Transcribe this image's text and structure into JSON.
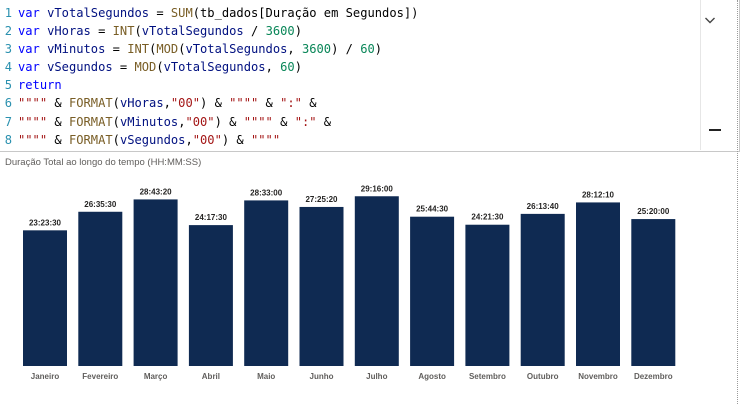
{
  "editor": {
    "lines": [
      {
        "n": "1",
        "tokens": [
          [
            "kw",
            "var "
          ],
          [
            "id",
            "vTotalSegundos"
          ],
          [
            "col",
            " = "
          ],
          [
            "fn",
            "SUM"
          ],
          [
            "col",
            "(tb_dados[Duração em Segundos])"
          ]
        ]
      },
      {
        "n": "2",
        "tokens": [
          [
            "kw",
            "var "
          ],
          [
            "id",
            "vHoras"
          ],
          [
            "col",
            " = "
          ],
          [
            "fn",
            "INT"
          ],
          [
            "col",
            "("
          ],
          [
            "id",
            "vTotalSegundos"
          ],
          [
            "col",
            " / "
          ],
          [
            "num",
            "3600"
          ],
          [
            "col",
            ")"
          ]
        ]
      },
      {
        "n": "3",
        "tokens": [
          [
            "kw",
            "var "
          ],
          [
            "id",
            "vMinutos"
          ],
          [
            "col",
            " = "
          ],
          [
            "fn",
            "INT"
          ],
          [
            "col",
            "("
          ],
          [
            "fn",
            "MOD"
          ],
          [
            "col",
            "("
          ],
          [
            "id",
            "vTotalSegundos"
          ],
          [
            "col",
            ", "
          ],
          [
            "num",
            "3600"
          ],
          [
            "col",
            ") / "
          ],
          [
            "num",
            "60"
          ],
          [
            "col",
            ")"
          ]
        ]
      },
      {
        "n": "4",
        "tokens": [
          [
            "kw",
            "var "
          ],
          [
            "id",
            "vSegundos"
          ],
          [
            "col",
            " = "
          ],
          [
            "fn",
            "MOD"
          ],
          [
            "col",
            "("
          ],
          [
            "id",
            "vTotalSegundos"
          ],
          [
            "col",
            ", "
          ],
          [
            "num",
            "60"
          ],
          [
            "col",
            ")"
          ]
        ]
      },
      {
        "n": "5",
        "tokens": [
          [
            "kw",
            "return"
          ]
        ]
      },
      {
        "n": "6",
        "tokens": [
          [
            "str",
            "\"\"\"\""
          ],
          [
            "col",
            " & "
          ],
          [
            "fn",
            "FORMAT"
          ],
          [
            "col",
            "("
          ],
          [
            "id",
            "vHoras"
          ],
          [
            "col",
            ","
          ],
          [
            "str",
            "\"00\""
          ],
          [
            "col",
            ") & "
          ],
          [
            "str",
            "\"\"\"\""
          ],
          [
            "col",
            " & "
          ],
          [
            "str",
            "\":\""
          ],
          [
            "col",
            " &"
          ]
        ]
      },
      {
        "n": "7",
        "tokens": [
          [
            "str",
            "\"\"\"\""
          ],
          [
            "col",
            " & "
          ],
          [
            "fn",
            "FORMAT"
          ],
          [
            "col",
            "("
          ],
          [
            "id",
            "vMinutos"
          ],
          [
            "col",
            ","
          ],
          [
            "str",
            "\"00\""
          ],
          [
            "col",
            ") & "
          ],
          [
            "str",
            "\"\"\"\""
          ],
          [
            "col",
            " & "
          ],
          [
            "str",
            "\":\""
          ],
          [
            "col",
            " &"
          ]
        ]
      },
      {
        "n": "8",
        "tokens": [
          [
            "str",
            "\"\"\"\""
          ],
          [
            "col",
            " & "
          ],
          [
            "fn",
            "FORMAT"
          ],
          [
            "col",
            "("
          ],
          [
            "id",
            "vSegundos"
          ],
          [
            "col",
            ","
          ],
          [
            "str",
            "\"00\""
          ],
          [
            "col",
            ") & "
          ],
          [
            "str",
            "\"\"\"\""
          ]
        ]
      }
    ],
    "expand_icon": "chevron-down-icon",
    "colors": {
      "keyword": "#0000ff",
      "identifier": "#001080",
      "function": "#795e26",
      "number": "#098658",
      "string": "#a31515",
      "line_number": "#2b91af"
    }
  },
  "chart": {
    "title": "Duração Total ao longo do tempo (HH:MM:SS)",
    "bar_color": "#0f2a52"
  },
  "chart_data": {
    "type": "bar",
    "title": "Duração Total ao longo do tempo (HH:MM:SS)",
    "xlabel": "",
    "ylabel": "",
    "categories": [
      "Janeiro",
      "Fevereiro",
      "Março",
      "Abril",
      "Maio",
      "Junho",
      "Julho",
      "Agosto",
      "Setembro",
      "Outubro",
      "Novembro",
      "Dezembro"
    ],
    "labels": [
      "23:23:30",
      "26:35:30",
      "28:43:20",
      "24:17:30",
      "28:33:00",
      "27:25:20",
      "29:16:00",
      "25:44:30",
      "24:21:30",
      "26:13:40",
      "28:12:10",
      "25:20:00"
    ],
    "values": [
      23.3917,
      26.5917,
      28.7222,
      24.2917,
      28.55,
      27.4222,
      29.2667,
      25.7417,
      24.3583,
      26.2278,
      28.2028,
      25.3333
    ],
    "units": "hours",
    "ylim": [
      0,
      30
    ],
    "grid": false,
    "legend": "none"
  }
}
